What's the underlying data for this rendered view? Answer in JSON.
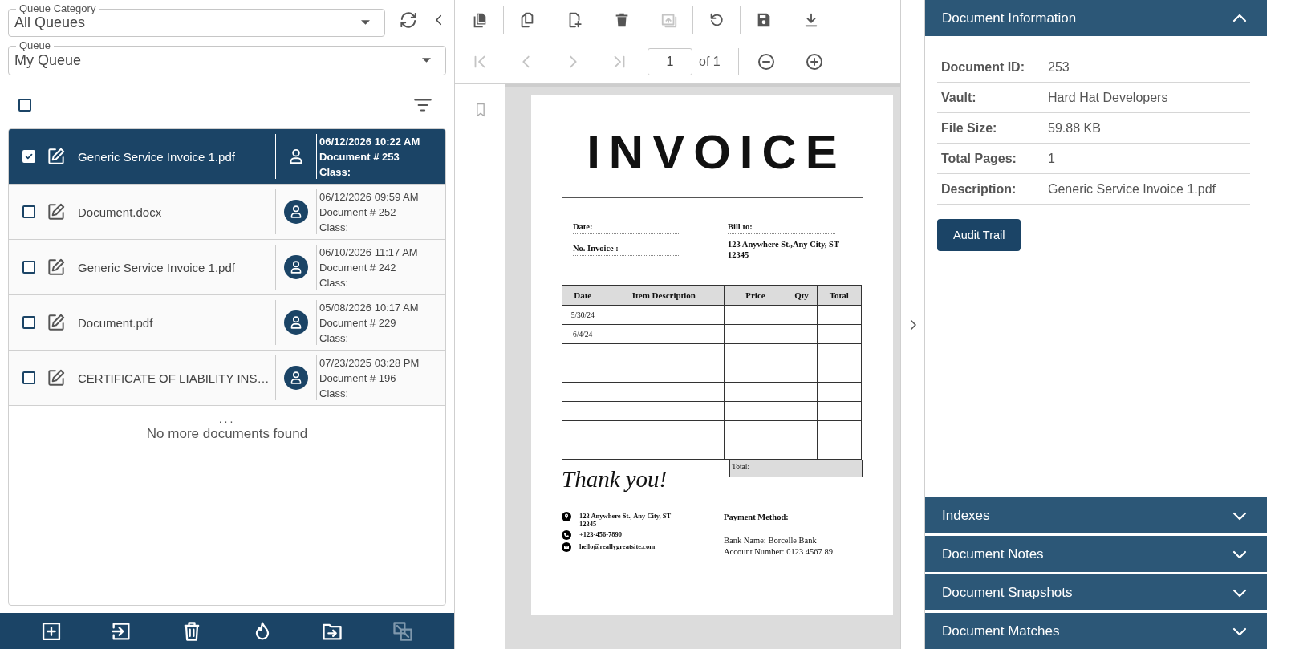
{
  "queue_filters": [
    {
      "label": "Queue Category",
      "value": "All Queues"
    },
    {
      "label": "Queue",
      "value": "My Queue"
    }
  ],
  "select_all": {
    "checked": false
  },
  "documents": [
    {
      "name": "Generic Service Invoice 1.pdf",
      "selected": true,
      "checked": true,
      "date": "06/12/2026 10:22 AM",
      "number": "Document # 253",
      "class": "Class:"
    },
    {
      "name": "Document.docx",
      "selected": false,
      "checked": false,
      "date": "06/12/2026 09:59 AM",
      "number": "Document # 252",
      "class": "Class:"
    },
    {
      "name": "Generic Service Invoice 1.pdf",
      "selected": false,
      "checked": false,
      "date": "06/10/2026 11:17 AM",
      "number": "Document # 242",
      "class": "Class:"
    },
    {
      "name": "Document.pdf",
      "selected": false,
      "checked": false,
      "date": "05/08/2026 10:17 AM",
      "number": "Document # 229",
      "class": "Class:"
    },
    {
      "name": "CERTIFICATE OF LIABILITY INS…",
      "selected": false,
      "checked": false,
      "date": "07/23/2025 03:28 PM",
      "number": "Document # 196",
      "class": "Class:"
    }
  ],
  "list_footer": {
    "ellipsis": "...",
    "message": "No more documents found"
  },
  "list_actions": [
    {
      "kind": "add-box",
      "disabled": false
    },
    {
      "kind": "import",
      "disabled": false
    },
    {
      "kind": "delete",
      "disabled": false
    },
    {
      "kind": "flame",
      "disabled": false
    },
    {
      "kind": "move",
      "disabled": false
    },
    {
      "kind": "swap",
      "disabled": true
    }
  ],
  "viewer": {
    "toolbar_groups": [
      [
        {
          "kind": "copy",
          "disabled": false
        }
      ],
      [
        {
          "kind": "pages",
          "disabled": false
        },
        {
          "kind": "add",
          "disabled": false
        },
        {
          "kind": "trash",
          "disabled": false
        },
        {
          "kind": "replace",
          "disabled": true
        }
      ],
      [
        {
          "kind": "undo",
          "disabled": false
        }
      ],
      [
        {
          "kind": "save",
          "disabled": false
        },
        {
          "kind": "download",
          "disabled": false
        }
      ]
    ],
    "nav": [
      {
        "kind": "first",
        "disabled": true
      },
      {
        "kind": "prev",
        "disabled": true
      },
      {
        "kind": "next",
        "disabled": true
      },
      {
        "kind": "last",
        "disabled": true
      }
    ],
    "page_input": "1",
    "page_count": "of 1",
    "zoom": [
      {
        "kind": "zoom-out",
        "disabled": false
      },
      {
        "kind": "zoom-in",
        "disabled": false
      }
    ]
  },
  "invoice": {
    "title": "INVOICE",
    "left_fields": [
      "Date:",
      "No. Invoice :"
    ],
    "bill_to": {
      "label": "Bill to:",
      "address": "123 Anywhere St.,Any City, ST 12345"
    },
    "columns": [
      "Date",
      "Item Description",
      "Price",
      "Qty",
      "Total"
    ],
    "row_dates": [
      "5/30/24",
      "6/4/24"
    ],
    "total_label": "Total:",
    "closing": "Thank you!",
    "contacts": [
      {
        "kind": "location",
        "text": "123 Anywhere St., Any City, ST 12345"
      },
      {
        "kind": "phone",
        "text": "+123-456-7890"
      },
      {
        "kind": "email",
        "text": "hello@reallygreatsite.com"
      }
    ],
    "payment": {
      "title": "Payment Method:",
      "lines": [
        "Bank Name: Borcelle Bank",
        "Account Number: 0123 4567 89"
      ]
    }
  },
  "document_information": {
    "title": "Document Information",
    "expanded": true,
    "fields": [
      {
        "label": "Document ID:",
        "value": "253"
      },
      {
        "label": "Vault:",
        "value": "Hard Hat Developers"
      },
      {
        "label": "File Size:",
        "value": "59.88 KB"
      },
      {
        "label": "Total Pages:",
        "value": "1"
      },
      {
        "label": "Description:",
        "value": "Generic Service Invoice 1.pdf"
      }
    ],
    "button": "Audit Trail"
  },
  "sections": [
    {
      "title": "Indexes",
      "expanded": false
    },
    {
      "title": "Document Notes",
      "expanded": false
    },
    {
      "title": "Document Snapshots",
      "expanded": false
    },
    {
      "title": "Document Matches",
      "expanded": false
    }
  ]
}
